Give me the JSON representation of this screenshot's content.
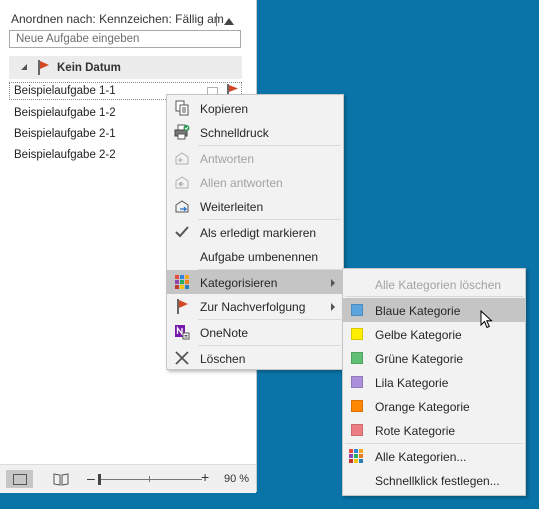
{
  "colors": {
    "desktop": "#0a74a8",
    "flag": "#d24726",
    "menu_bg": "#f2f2f2",
    "highlight": "#c5c5c5"
  },
  "sort": {
    "label": "Anordnen nach: Kennzeichen: Fällig am"
  },
  "new_task": {
    "placeholder": "Neue Aufgabe eingeben"
  },
  "group": {
    "label": "Kein Datum",
    "icon": "flag-icon"
  },
  "tasks": [
    {
      "name": "Beispielaufgabe 1-1"
    },
    {
      "name": "Beispielaufgabe 1-2"
    },
    {
      "name": "Beispielaufgabe 2-1"
    },
    {
      "name": "Beispielaufgabe 2-2"
    }
  ],
  "statusbar": {
    "zoom": "90 %",
    "zoom_minus": "–",
    "zoom_plus": "+"
  },
  "context_menu": {
    "items": [
      {
        "label": "Kopieren",
        "icon": "copy-icon",
        "enabled": true
      },
      {
        "label": "Schnelldruck",
        "icon": "quick-print-icon",
        "enabled": true
      },
      {
        "label": "Antworten",
        "icon": "reply-icon",
        "enabled": false
      },
      {
        "label": "Allen antworten",
        "icon": "reply-all-icon",
        "enabled": false
      },
      {
        "label": "Weiterleiten",
        "icon": "forward-icon",
        "enabled": true
      },
      {
        "label": "Als erledigt markieren",
        "icon": "checkmark-icon",
        "enabled": true
      },
      {
        "label": "Aufgabe umbenennen",
        "icon": "",
        "enabled": true
      },
      {
        "label": "Kategorisieren",
        "icon": "categorize-icon",
        "enabled": true,
        "submenu": true,
        "highlighted": true
      },
      {
        "label": "Zur Nachverfolgung",
        "icon": "flag-icon",
        "enabled": true,
        "submenu": true
      },
      {
        "label": "OneNote",
        "icon": "onenote-icon",
        "enabled": true
      },
      {
        "label": "Löschen",
        "icon": "delete-icon",
        "enabled": true
      }
    ]
  },
  "category_menu": {
    "clear_all": "Alle Kategorien löschen",
    "categories": [
      {
        "label": "Blaue Kategorie",
        "color": "#5ba4de"
      },
      {
        "label": "Gelbe Kategorie",
        "color": "#ffee00"
      },
      {
        "label": "Grüne Kategorie",
        "color": "#5fbf72"
      },
      {
        "label": "Lila Kategorie",
        "color": "#a98fdc"
      },
      {
        "label": "Orange Kategorie",
        "color": "#ff8600"
      },
      {
        "label": "Rote Kategorie",
        "color": "#ec7d83"
      }
    ],
    "all_categories": "Alle Kategorien...",
    "quick_click": "Schnellklick festlegen..."
  }
}
